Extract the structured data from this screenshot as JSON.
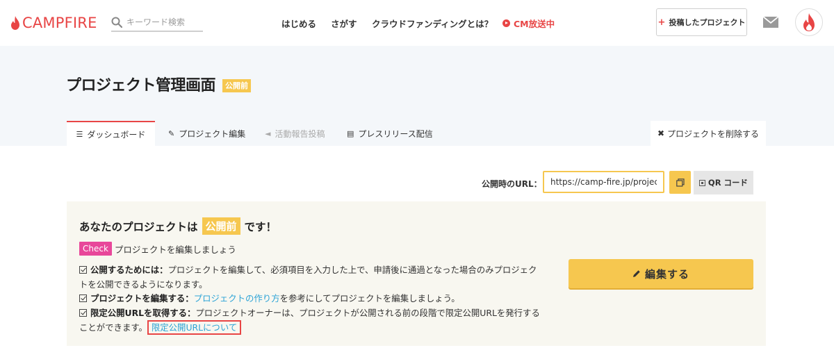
{
  "header": {
    "logo_text": "CAMPFIRE",
    "search_placeholder": "キーワード検索",
    "nav": [
      {
        "label": "はじめる"
      },
      {
        "label": "さがす"
      },
      {
        "label": "クラウドファンディングとは？"
      },
      {
        "label": "CM放送中"
      }
    ],
    "posted_projects_label": "投稿したプロジェクト"
  },
  "page": {
    "title": "プロジェクト管理画面",
    "status_badge": "公開前"
  },
  "tabs": [
    {
      "label": "ダッシュボード",
      "icon": "list-icon",
      "active": true
    },
    {
      "label": "プロジェクト編集",
      "icon": "pencil-icon"
    },
    {
      "label": "活動報告投稿",
      "icon": "megaphone-icon",
      "disabled": true
    },
    {
      "label": "プレスリリース配信",
      "icon": "document-icon"
    }
  ],
  "delete_tab_label": "プロジェクトを削除する",
  "url_row": {
    "label": "公開時のURL：",
    "value": "https://camp-fire.jp/projects",
    "qr_label": "QR コード"
  },
  "notice": {
    "title_prefix": "あなたのプロジェクトは",
    "status": "公開前",
    "title_suffix": "です！",
    "check_badge": "Check",
    "check_text": "プロジェクトを編集しましょう",
    "items": [
      {
        "bold": "公開するためには：",
        "text": "プロジェクトを編集して、必須項目を入力した上で、申請後に通過となった場合のみプロジェクトを公開できるようになります。"
      },
      {
        "bold": "プロジェクトを編集する：",
        "link": "プロジェクトの作り方",
        "text": "を参考にしてプロジェクトを編集しましょう。"
      },
      {
        "bold": "限定公開URLを取得する：",
        "text": "プロジェクトオーナーは、プロジェクトが公開される前の段階で限定公開URLを発行することができます。",
        "link": "限定公開URLについて"
      }
    ],
    "edit_button_label": "編集する"
  },
  "colors": {
    "brand": "#e84545",
    "accent_yellow": "#f6c74f",
    "check_pink": "#e8479a",
    "link_blue": "#2ba3d6",
    "band_bg": "#f4f7fa",
    "box_bg": "#f8f7f0"
  }
}
